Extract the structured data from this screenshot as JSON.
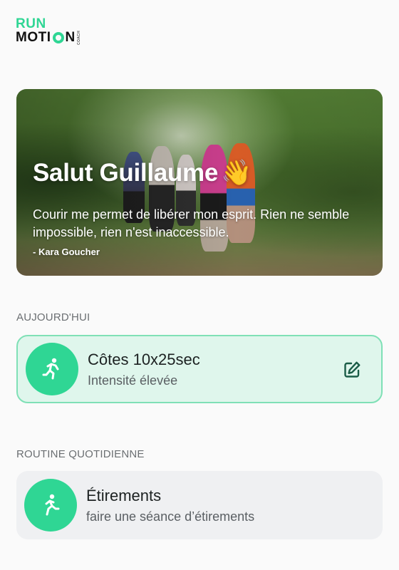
{
  "logo": {
    "line1": "RUN",
    "line2_left": "MOTI",
    "line2_right": "N",
    "tagline": "COACH"
  },
  "hero": {
    "greeting": "Salut Guillaume",
    "wave_emoji": "👋",
    "quote": "Courir me permet de libérer mon esprit. Rien ne semble impossible, rien n'est inaccessible.",
    "author": "- Kara Goucher"
  },
  "today": {
    "section_label": "AUJOURD'HUI",
    "workout_title": "Côtes 10x25sec",
    "workout_subtitle": "Intensité élevée",
    "icon": "runner-icon",
    "action_icon": "edit-icon"
  },
  "routine": {
    "section_label": "ROUTINE QUOTIDIENNE",
    "title": "Étirements",
    "subtitle": "faire une séance d’étirements",
    "icon": "stretching-icon"
  },
  "colors": {
    "accent": "#2fd694",
    "today_card_bg": "#dff6ec",
    "today_card_border": "#7fe0b6",
    "routine_card_bg": "#eff0f2"
  }
}
